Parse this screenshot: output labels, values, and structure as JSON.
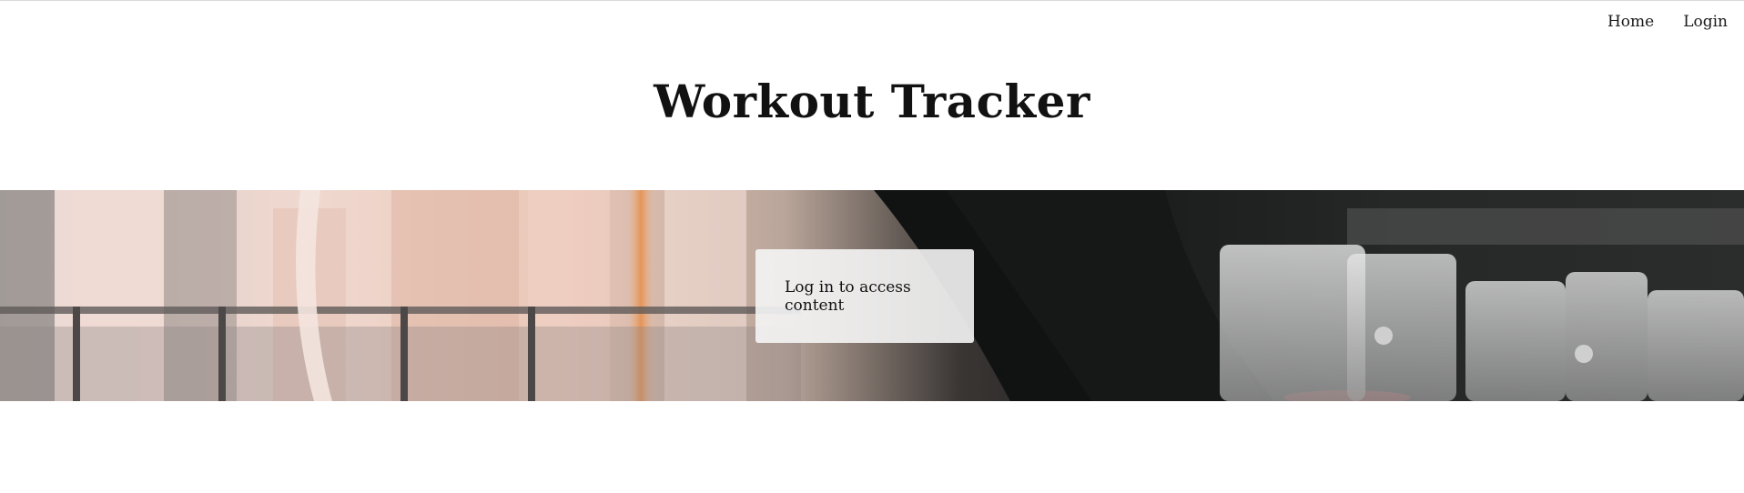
{
  "nav": {
    "home_label": "Home",
    "login_label": "Login"
  },
  "header": {
    "title": "Workout Tracker"
  },
  "hero": {
    "image_subject": "gym-treadmill-photo",
    "message": "Log in to access content"
  }
}
